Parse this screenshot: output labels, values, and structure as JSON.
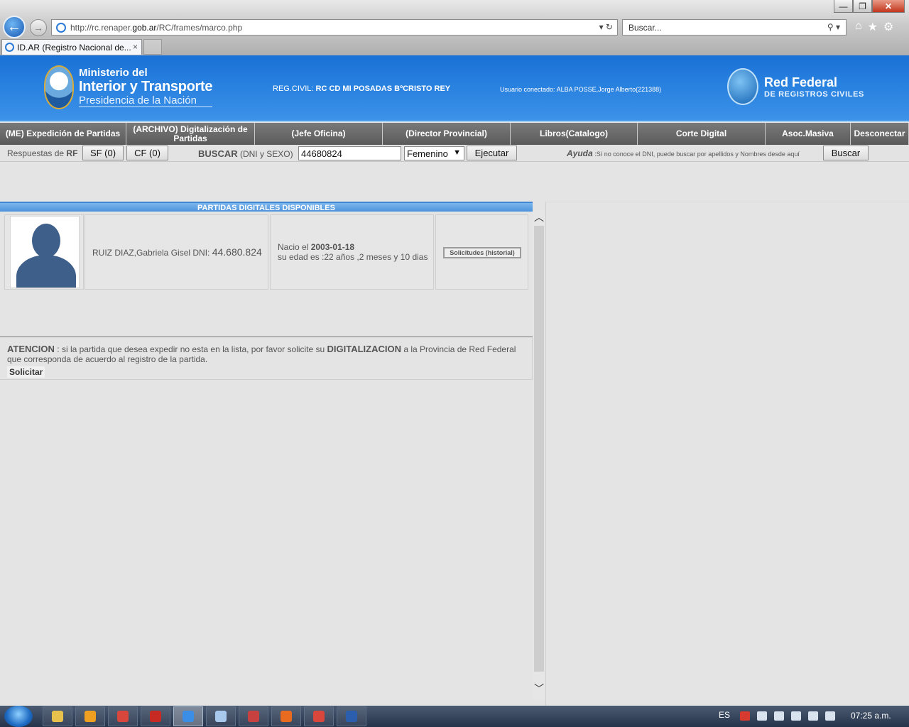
{
  "browser": {
    "url_prefix": "http://rc.renaper.",
    "url_domain": "gob.ar",
    "url_path": "/RC/frames/marco.php",
    "search_placeholder": "Buscar...",
    "tab_title": "ID.AR (Registro Nacional de...",
    "tab_close": "×",
    "window_buttons": {
      "minimize": "—",
      "restore": "❐",
      "close": "✕"
    }
  },
  "header": {
    "ministry_line1": "Ministerio del",
    "ministry_line2": "Interior y Transporte",
    "ministry_line3": "Presidencia de la Nación",
    "reg_label": "REG.CIVIL:",
    "reg_value": "RC CD MI POSADAS BºCRISTO REY",
    "user_label": "Usuario conectado:",
    "user_value": "ALBA POSSE,Jorge Alberto(221388)",
    "rf_title": "Red Federal",
    "rf_subtitle": "DE REGISTROS CIVILES"
  },
  "menu": {
    "items": [
      {
        "label": "(ME) Expedición de Partidas"
      },
      {
        "label": "(ARCHIVO) Digitalización de Partidas"
      },
      {
        "label": "(Jefe Oficina)"
      },
      {
        "label": "(Director Provincial)"
      },
      {
        "label": "Libros(Catalogo)"
      },
      {
        "label": "Corte Digital"
      },
      {
        "label": "Asoc.Masiva"
      },
      {
        "label": "Desconectar"
      }
    ]
  },
  "searchbar": {
    "respuestas_label": "Respuestas de",
    "respuestas_rf": "RF",
    "sf_button": "SF (0)",
    "cf_button": "CF (0)",
    "buscar_label": "BUSCAR",
    "buscar_hint": "(DNI y SEXO)",
    "dni_value": "44680824",
    "sex_value": "Femenino",
    "ejecutar": "Ejecutar",
    "ayuda_label": "Ayuda",
    "ayuda_text": ":Sí no conoce el DNI, puede buscar por apellidos y Nombres desde aquí",
    "buscar_button": "Buscar"
  },
  "results": {
    "header": "PARTIDAS DIGITALES DISPONIBLES",
    "record": {
      "name": "RUIZ DIAZ,Gabriela Gisel DNI:",
      "dni": "44.680.824",
      "birth_label": "Nacio el",
      "birth_date": "2003-01-18",
      "age_text": "su edad es :22 años ,2 meses y 10 dias",
      "history_button": "Solicitudes (historial)"
    },
    "atencion_title": "ATENCION",
    "atencion_text_1": ": si la partida que desea expedir no esta en la lista, por favor solicite su",
    "atencion_bold": "DIGITALIZACION",
    "atencion_text_2": "a la Provincia de Red Federal que corresponda de acuerdo al registro de la partida.",
    "solicitar": "Solicitar"
  },
  "scrollbar": {
    "up": "︿",
    "down": "﹀"
  },
  "taskbar": {
    "language": "ES",
    "time": "07:25 a.m.",
    "apps": [
      {
        "name": "explorer",
        "color": "#e8c04c"
      },
      {
        "name": "media",
        "color": "#f0a020"
      },
      {
        "name": "chrome",
        "color": "#d9473c"
      },
      {
        "name": "acrobat",
        "color": "#c62a22"
      },
      {
        "name": "internet-explorer",
        "color": "#3a8ee6",
        "active": true
      },
      {
        "name": "notepad",
        "color": "#a9c9ec"
      },
      {
        "name": "presentation",
        "color": "#c84141"
      },
      {
        "name": "firefox",
        "color": "#e86b1f"
      },
      {
        "name": "chrome-2",
        "color": "#d9473c"
      },
      {
        "name": "word",
        "color": "#2b5fae"
      }
    ]
  }
}
